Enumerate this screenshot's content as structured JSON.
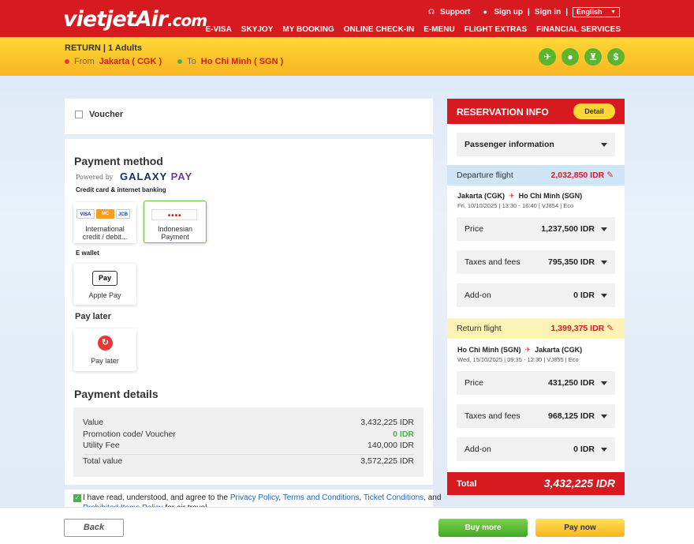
{
  "header": {
    "logo_main": "vietjet",
    "logo_air": "Air",
    "logo_domain": ".com",
    "support": "Support",
    "signup": "Sign up",
    "signin": "Sign in",
    "language": "English",
    "nav": [
      "E-VISA",
      "SKYJOY",
      "MY BOOKING",
      "ONLINE CHECK-IN",
      "E-MENU",
      "FLIGHT EXTRAS",
      "FINANCIAL SERVICES"
    ]
  },
  "trip": {
    "type": "RETURN | 1 Adults",
    "from_label": "From",
    "from_city": "Jakarta ( CGK )",
    "to_label": "To",
    "to_city": "Ho Chi Minh ( SGN )"
  },
  "voucher": {
    "label": "Voucher"
  },
  "payment_method": {
    "title": "Payment method",
    "powered_by": "Powered by",
    "galaxy": "GALAXY",
    "galaxy_pay": "PAY",
    "credit_label": "Credit card & internet banking",
    "options_card": [
      {
        "line1": "International",
        "line2": "credit / debit..."
      },
      {
        "line1": "Indonesian",
        "line2": "Payment"
      }
    ],
    "visa": "VISA",
    "mc": "MC",
    "jcb": "JCB",
    "ewallet_label": "E wallet",
    "applepay_icon": "Pay",
    "applepay": "Apple Pay",
    "paylater_label": "Pay later",
    "paylater": "Pay later"
  },
  "payment_details": {
    "title": "Payment details",
    "value_label": "Value",
    "value": "3,432,225 IDR",
    "promo_label": "Promotion code/ Voucher",
    "promo": "0 IDR",
    "utility_label": "Utility Fee",
    "utility": "140,000 IDR",
    "total_label": "Total value",
    "total": "3,572,225 IDR"
  },
  "agreement": {
    "prefix": "I have read, understood, and agree to the ",
    "privacy": "Privacy Policy",
    "terms": "Terms and Conditions",
    "ticket": "Ticket Conditions",
    "and": ", and",
    "prohibited": "Prohibited Items Policy",
    "suffix": " for air travel"
  },
  "reservation": {
    "title": "RESERVATION INFO",
    "detail_btn": "Detail",
    "passenger": "Passenger information",
    "departure": {
      "label": "Departure flight",
      "amount": "2,032,850 IDR",
      "from": "Jakarta (CGK)",
      "to": "Ho Chi Minh (SGN)",
      "date": "Fri, 10/10/2025 | 13:30 - 16:40 | VJ854 | Eco",
      "price": "1,237,500 IDR",
      "taxes": "795,350 IDR",
      "addon": "0 IDR"
    },
    "return": {
      "label": "Return flight",
      "amount": "1,399,375 IDR",
      "from": "Ho Chi Minh (SGN)",
      "to": "Jakarta (CGK)",
      "date": "Wed, 15/10/2025 | 09:35 - 12:30 | VJ855 | Eco",
      "price": "431,250 IDR",
      "taxes": "968,125 IDR",
      "addon": "0 IDR"
    },
    "price_label": "Price",
    "taxes_label": "Taxes and fees",
    "addon_label": "Add-on",
    "total_label": "Total",
    "total": "3,432,225 IDR"
  },
  "footer": {
    "back": "Back",
    "buy_more": "Buy more",
    "pay_now": "Pay now"
  },
  "colors": {
    "brand_red": "#d71920",
    "brand_yellow": "#fdd835",
    "accent_green": "#5cb531"
  }
}
